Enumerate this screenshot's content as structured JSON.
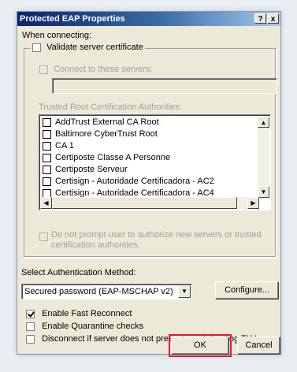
{
  "window": {
    "title": "Protected EAP Properties",
    "help_label": "?",
    "close_label": "x"
  },
  "connecting": {
    "label": "When connecting:",
    "validate_label": "Validate server certificate",
    "validate_checked": false,
    "connect_label": "Connect to these servers:",
    "servers_value": "",
    "trusted_label": "Trusted Root Certification Authorities:",
    "authorities": [
      {
        "label": "AddTrust External CA Root",
        "checked": false
      },
      {
        "label": "Baltimore CyberTrust Root",
        "checked": false
      },
      {
        "label": "CA 1",
        "checked": false
      },
      {
        "label": "Certiposte Classe A Personne",
        "checked": false
      },
      {
        "label": "Certiposte Serveur",
        "checked": false
      },
      {
        "label": "Certisign - Autoridade Certificadora - AC2",
        "checked": false
      },
      {
        "label": "Certisign - Autoridade Certificadora - AC4",
        "checked": false
      }
    ],
    "no_prompt_line1": "Do not prompt user to authorize new servers or trusted",
    "no_prompt_line2": "certification authorities."
  },
  "auth": {
    "label": "Select Authentication Method:",
    "selected": "Secured password (EAP-MSCHAP v2)",
    "configure_label": "Configure..."
  },
  "options": {
    "fast_reconnect_label": "Enable Fast Reconnect",
    "fast_reconnect_checked": true,
    "quarantine_label": "Enable Quarantine checks",
    "quarantine_checked": false,
    "disconnect_label": "Disconnect if server does not present cryptobinding TLV",
    "disconnect_checked": false
  },
  "buttons": {
    "ok_label": "OK",
    "cancel_label": "Cancel"
  },
  "colors": {
    "title_start": "#0a246a",
    "title_end": "#a6caf0",
    "highlight": "#e0192b",
    "dialog_bg": "#ece9d8"
  }
}
